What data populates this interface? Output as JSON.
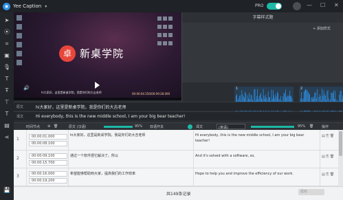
{
  "titlebar": {
    "app_name": "Yee Caption",
    "pro_label": "PRO",
    "caret": "▾",
    "minimize": "—",
    "maximize": "☐",
    "close": "✕"
  },
  "video": {
    "brand_char": "卓",
    "brand_text": "新桌学院",
    "caption": "hi大家好，这里是新桌学院，我是你们的大吉老师",
    "timecode": "00:00:04.550/00:09:28.000"
  },
  "right_panel": {
    "tab_label": "字幕样式题",
    "add_label": "+ 添加样式"
  },
  "waveform": {
    "segment_labels": [
      "1",
      "2"
    ]
  },
  "sublines": {
    "line1_label": "原文",
    "line1_text": "hi大家好，这里是新桌学院，我是你们的大吉老师",
    "line2_label": "译文",
    "line2_text": "Hi everybody, this is the new middle school, I am your big bear teacher!"
  },
  "columns": {
    "time_header": "时间节点",
    "source_header": "原文 (汉语)",
    "source_pct": "95%",
    "source_toggle_label": "双语开关",
    "target_header": "译文",
    "target_lang": "(英语)",
    "target_pct": "95%",
    "ops_header": "操作"
  },
  "rows": [
    {
      "index": "1",
      "start": "00:00:01.000",
      "end": "00:00:08.100",
      "source": "hi大家好，这里是新桌学院，我是你们的大吉老师",
      "target": "Hi everybody, this is the new middle school, I am your big bear teacher!"
    },
    {
      "index": "2",
      "start": "00:00:09.100",
      "end": "00:00:15.700",
      "source": "通过一个软件把它解决了。所以",
      "target": "And it's solved with a software, so,"
    },
    {
      "index": "3",
      "start": "00:00:16.000",
      "end": "00:00:19.200",
      "source": "希望能够帮助到大家，提高我们的工作效率",
      "target": "Hope to help you and improve the efficiency of our work."
    }
  ],
  "footer": {
    "count_text": "共149条记录",
    "watermark": "鼠标"
  },
  "colors": {
    "accent": "#1db9a6",
    "brand_red": "#e8473b",
    "wave_blue": "#1f6fb3"
  }
}
